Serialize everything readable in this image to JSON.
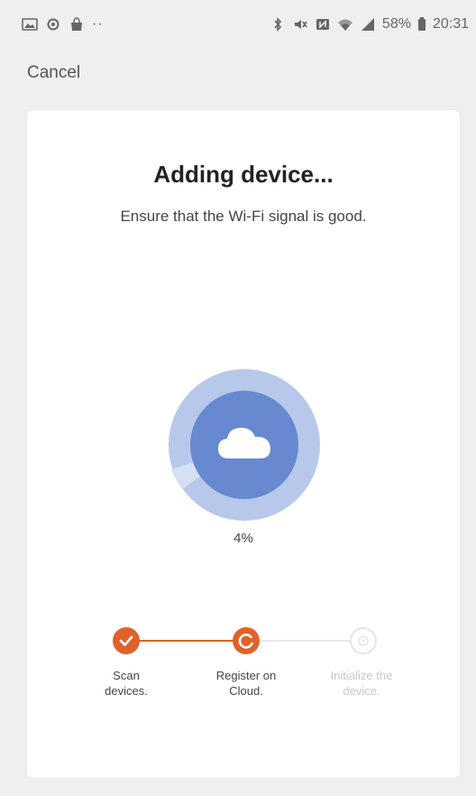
{
  "status_bar": {
    "battery": "58%",
    "time": "20:31",
    "more": "··"
  },
  "cancel_label": "Cancel",
  "card": {
    "title": "Adding device...",
    "subtitle": "Ensure that the Wi-Fi signal is good.",
    "progress_value": 4,
    "progress_text": "4%"
  },
  "steps": [
    {
      "line1": "Scan",
      "line2": "devices.",
      "state": "done"
    },
    {
      "line1": "Register on",
      "line2": "Cloud.",
      "state": "active"
    },
    {
      "line1": "Initialize the",
      "line2": "device.",
      "state": "pending"
    }
  ],
  "colors": {
    "accent": "#e0622a",
    "ring_outer": "#b8c8ea",
    "ring_inner": "#6689d0",
    "pending": "#e4e4e4"
  }
}
